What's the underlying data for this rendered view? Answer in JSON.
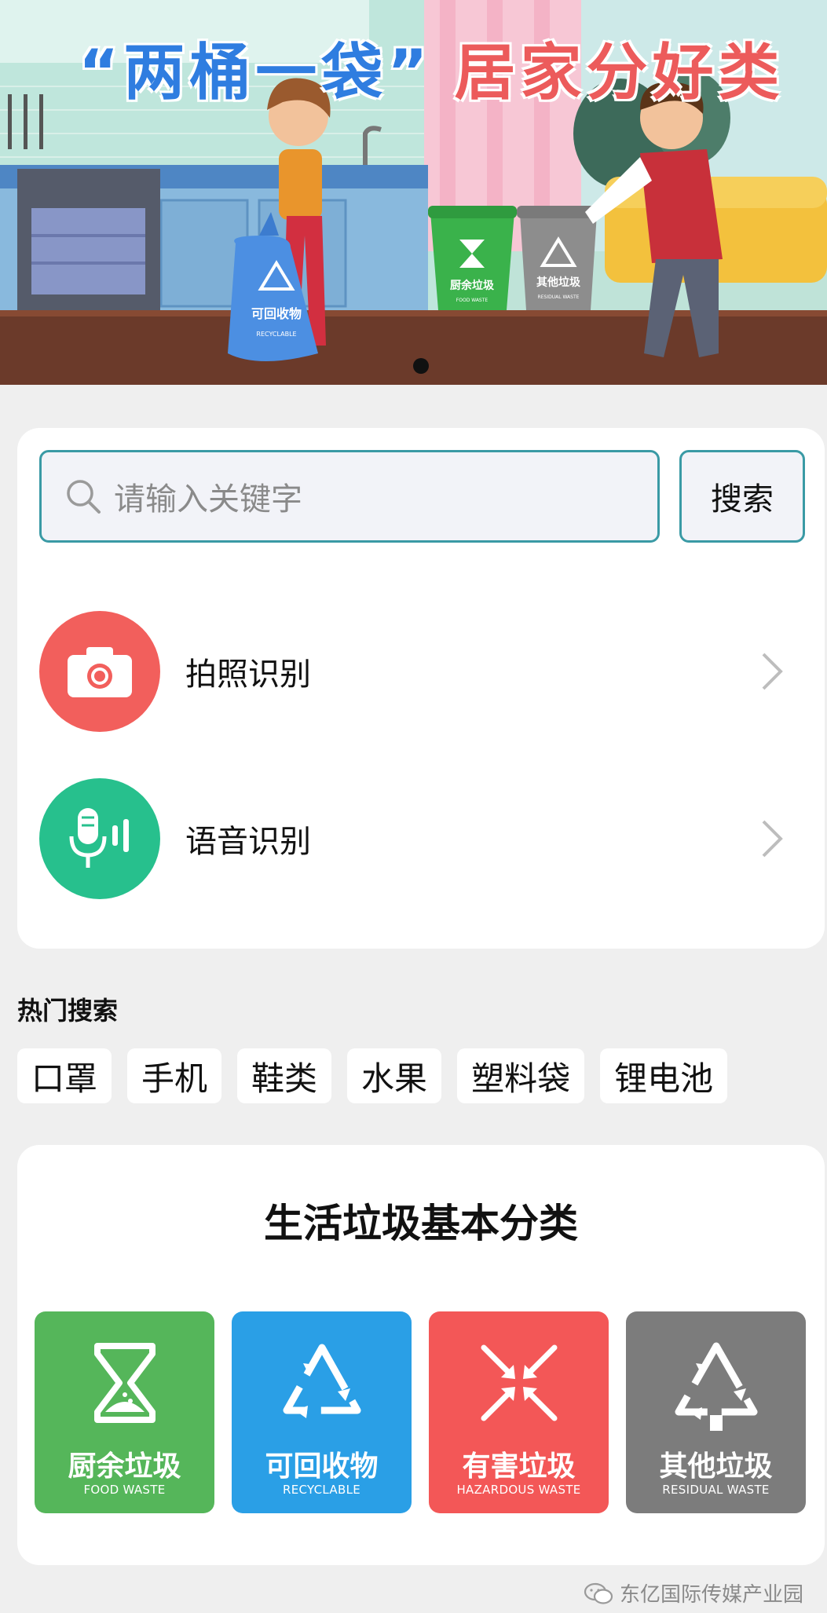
{
  "banner": {
    "title_quoted": "“两桶一袋”",
    "title_rest": "居家分好类",
    "bag_label": "可回收物",
    "bag_label_en": "RECYCLABLE",
    "green_bin_label": "厨余垃圾",
    "green_bin_label_en": "FOOD WASTE",
    "gray_bin_label": "其他垃圾",
    "gray_bin_label_en": "RESIDUAL WASTE"
  },
  "search": {
    "placeholder": "请输入关键字",
    "button_label": "搜索"
  },
  "actions": [
    {
      "label": "拍照识别",
      "icon": "camera-icon"
    },
    {
      "label": "语音识别",
      "icon": "microphone-icon"
    }
  ],
  "hot": {
    "title": "热门搜索",
    "tags": [
      "口罩",
      "手机",
      "鞋类",
      "水果",
      "塑料袋",
      "锂电池"
    ]
  },
  "categories": {
    "title": "生活垃圾基本分类",
    "items": [
      {
        "cn": "厨余垃圾",
        "en": "FOOD WASTE",
        "color": "#55b65a",
        "icon": "hourglass-icon"
      },
      {
        "cn": "可回收物",
        "en": "RECYCLABLE",
        "color": "#2a9fe6",
        "icon": "recycle-icon"
      },
      {
        "cn": "有害垃圾",
        "en": "HAZARDOUS WASTE",
        "color": "#f35757",
        "icon": "hazard-arrows-icon"
      },
      {
        "cn": "其他垃圾",
        "en": "RESIDUAL WASTE",
        "color": "#7c7c7c",
        "icon": "recycle-icon"
      }
    ]
  },
  "footer": {
    "watermark": "东亿国际传媒产业园"
  }
}
